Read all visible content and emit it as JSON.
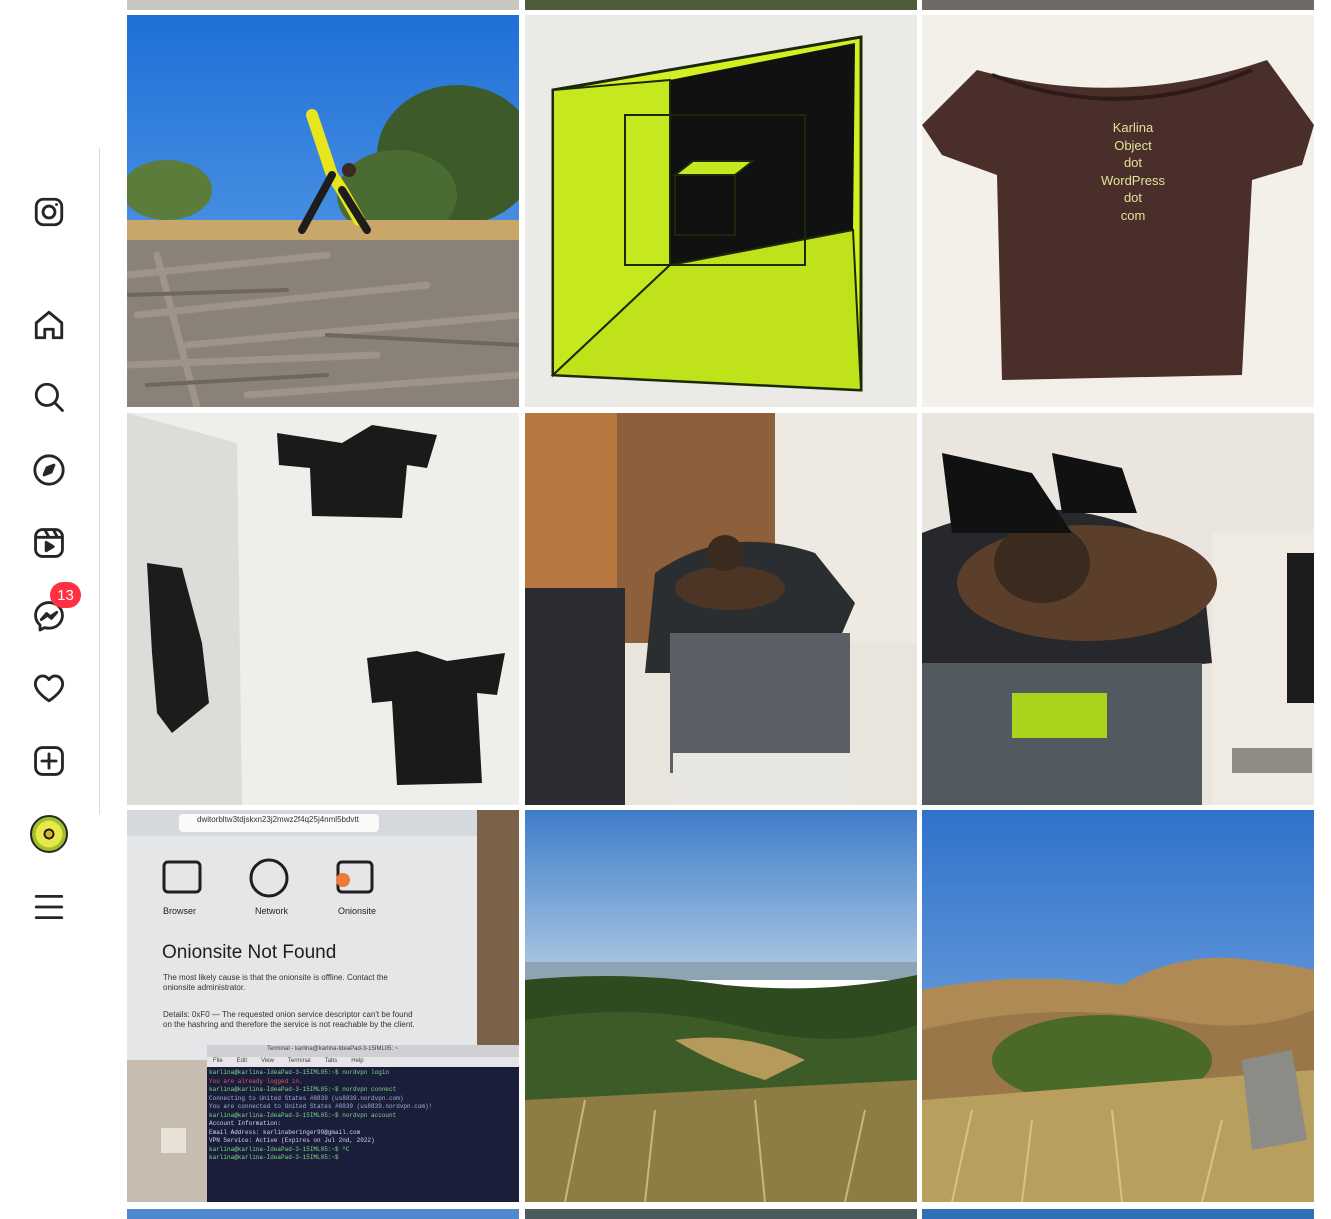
{
  "nav": {
    "messages_badge": "13"
  },
  "icons": {
    "logo": "instagram-icon",
    "home": "home-icon",
    "search": "search-icon",
    "explore": "compass-icon",
    "reels": "reels-icon",
    "messages": "messenger-icon",
    "notifications": "heart-icon",
    "create": "plus-square-icon",
    "profile": "avatar",
    "more": "menu-icon"
  },
  "posts": {
    "shirt_text": [
      "Karlina",
      "Object",
      "dot",
      "WordPress",
      "dot",
      "com"
    ],
    "screenshot": {
      "url": "dwitorbltw3tdjskxn23j2mwz2f4q25j4nml5bdvtt",
      "toolbar": [
        "Browser",
        "Network",
        "Onionsite"
      ],
      "title": "Onionsite Not Found",
      "body1": "The most likely cause is that the onionsite is offline. Contact the onionsite administrator.",
      "body2": "Details: 0xF0 — The requested onion service descriptor can't be found on the hashring and therefore the service is not reachable by the client.",
      "terminal_title": "Terminal - karlina@karlina-IdeaPad-3-15IML05: ~",
      "terminal_menu": [
        "File",
        "Edit",
        "View",
        "Terminal",
        "Tabs",
        "Help"
      ],
      "terminal_lines": [
        "karlina@karlina-IdeaPad-3-15IML05:~$ nordvpn login",
        "You are already logged in.",
        "karlina@karlina-IdeaPad-3-15IML05:~$ nordvpn connect",
        "Connecting to United States #8839 (us8839.nordvpn.com)",
        "You are connected to United States #8839 (us8839.nordvpn.com)!",
        "karlina@karlina-IdeaPad-3-15IML05:~$ nordvpn account",
        "Account Information:",
        "Email Address: karlinaberinger99@gmail.com",
        "VPN Service: Active (Expires on Jul 2nd, 2022)",
        "karlina@karlina-IdeaPad-3-15IML05:~$ ^C",
        "karlina@karlina-IdeaPad-3-15IML05:~$ "
      ]
    }
  },
  "colors": {
    "badge": "#ff3040",
    "divider": "#dbdbdb",
    "icon": "#262626"
  }
}
